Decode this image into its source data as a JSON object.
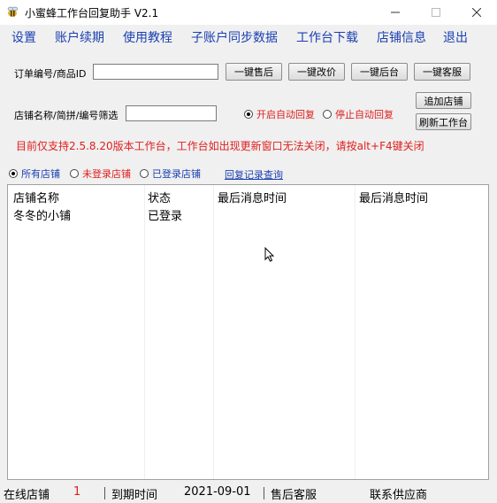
{
  "window": {
    "title": "小蜜蜂工作台回复助手  V2.1"
  },
  "menu": [
    "设置",
    "账户续期",
    "使用教程",
    "子账户同步数据",
    "工作台下载",
    "店铺信息",
    "退出"
  ],
  "form": {
    "order_label": "订单编号/商品ID",
    "order_value": "",
    "shop_filter_label": "店铺名称/简拼/编号筛选",
    "shop_filter_value": ""
  },
  "buttons": {
    "after_sale": "一键售后",
    "change_price": "一键改价",
    "backend": "一键后台",
    "customer_service": "一键客服",
    "add_shop": "追加店铺",
    "refresh": "刷新工作台"
  },
  "auto_reply": {
    "on_label": "开启自动回复",
    "off_label": "停止自动回复",
    "selected": "on"
  },
  "notice": "目前仅支持2.5.8.20版本工作台，工作台如出现更新窗口无法关闭，请按alt+F4键关闭",
  "filter": {
    "all_label": "所有店铺",
    "not_logged_label": "未登录店铺",
    "logged_label": "已登录店铺",
    "selected": "all",
    "reply_log_link": "回复记录查询"
  },
  "table": {
    "columns": [
      "店铺名称",
      "状态",
      "最后消息时间",
      "最后消息时间"
    ],
    "rows": [
      [
        "冬冬的小铺",
        "已登录",
        "",
        ""
      ]
    ]
  },
  "status_bar": {
    "online_label": "在线店铺",
    "online_count": "1",
    "expire_label": "到期时间",
    "expire_date": "2021-09-01",
    "after_sales_label": "售后客服",
    "supplier_label": "联系供应商"
  },
  "colors": {
    "menu": "#1a3fb0",
    "notice": "#e01e1e",
    "accent_red": "#e01e1e",
    "link": "#1a3fb0"
  }
}
